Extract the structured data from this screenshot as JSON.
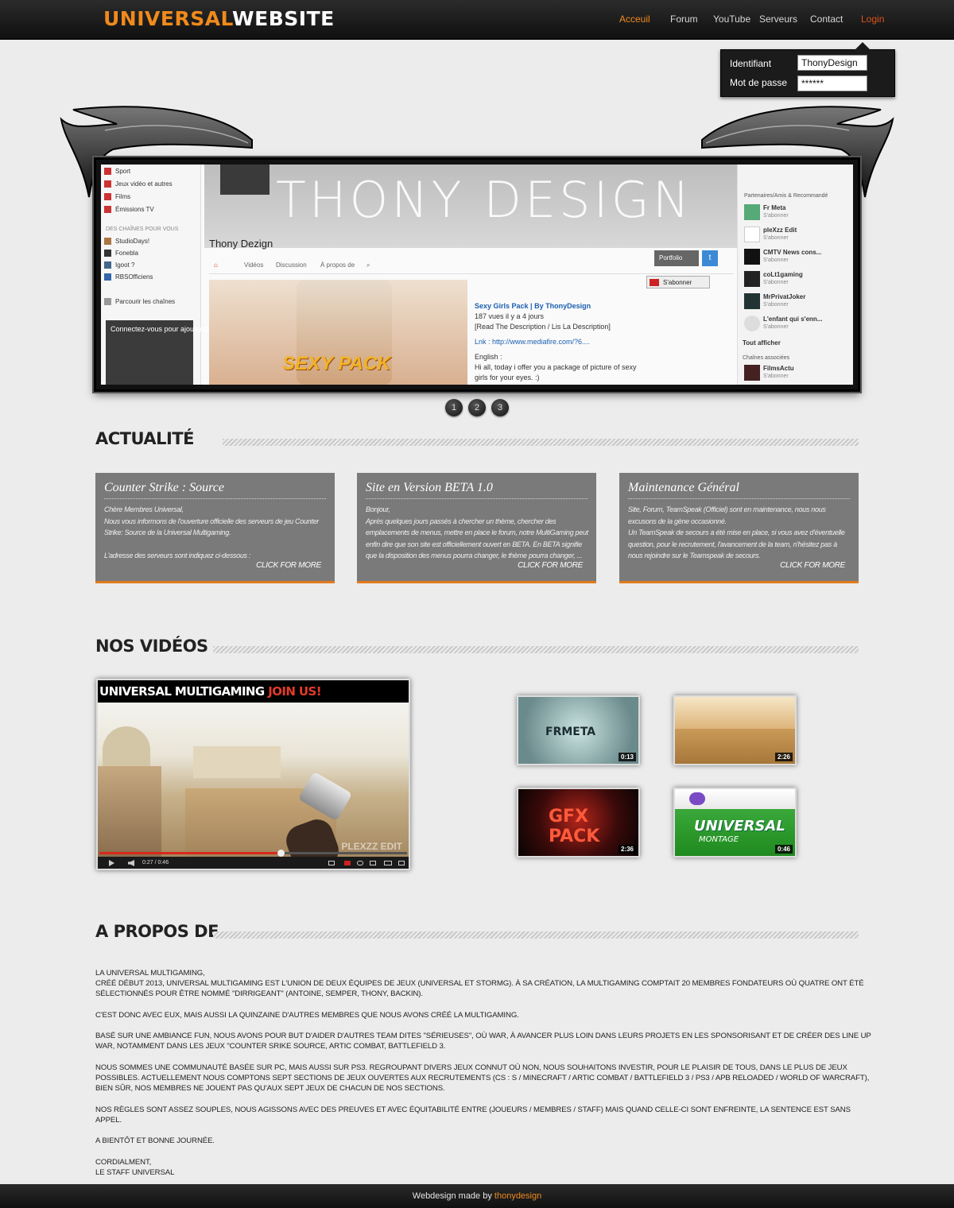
{
  "header": {
    "logo_part1": "UNIVERSAL",
    "logo_part2": "WEBSITE",
    "nav": [
      "Acceuil",
      "Forum",
      "YouTube",
      "Serveurs",
      "Contact",
      "Login"
    ]
  },
  "login": {
    "id_label": "Identifiant",
    "id_value": "ThonyDesign",
    "pw_label": "Mot de passe",
    "pw_value": "******"
  },
  "slider": {
    "sidebar": [
      "Sport",
      "Jeux vidéo et autres",
      "Films",
      "Émissions TV",
      "DES CHAÎNES POUR VOUS",
      "StudioDays!",
      "Fonebla",
      "Igoot ?",
      "RBSOfficiens",
      "Parcourir les chaînes"
    ],
    "promo": "Connectez-vous pour ajouter des chaînes à votre guide et bénéficier d'excellentes recommandations !",
    "banner_text": "THONY DESIGN",
    "channel_name": "Thony Dezign",
    "tabs": [
      "Vidéos",
      "Discussion",
      "À propos de"
    ],
    "portfolio": "Portfolio",
    "subscribe": "S'abonner",
    "video_overlay": "SEXY PACK",
    "desc_title": "Sexy Girls Pack | By ThonyDesign",
    "desc_meta": "187 vues  il y a 4 jours",
    "desc_line1": "[Read The Description / Lis La Description]",
    "desc_line2": "Lnk : http://www.mediafire.com/?6....",
    "desc_line3": "English :",
    "desc_line4": "Hi all, today i offer you a package of picture of sexy girls for your eyes. :)",
    "right_title": "Partenaires/Amis & Recommandé",
    "right_items": [
      "Fr Meta",
      "pleXzz Edit",
      "CMTV News cons...",
      "coLt1gaming",
      "MrPrivatJoker",
      "L'enfant qui s'enn..."
    ],
    "right_sub": "S'abonner",
    "right_more": "Tout afficher",
    "right_assoc": "Chaînes associées",
    "right_last": "FilmsActu",
    "dots": [
      "1",
      "2",
      "3"
    ]
  },
  "actualite": {
    "title": "ACTUALITÉ",
    "more_label": "CLICK FOR MORE",
    "cards": [
      {
        "title": "Counter Strike : Source",
        "body": "Chère Membres Universal,\nNous vous informons de l'ouverture officielle des serveurs de jeu Counter Strike: Source de la Universal Multigaming.\n\nL'adresse des serveurs sont indiquez ci-dessous :"
      },
      {
        "title": "Site en Version BETA 1.0",
        "body": "Bonjour,\nAprès quelques jours passés à chercher un thème, chercher des emplacements de menus, mettre en place le forum, notre MultiGaming peut enfin dire que son site est officiellement ouvert en BETA. En BETA signifie que la disposition des menus pourra changer, le thème pourra changer, ..."
      },
      {
        "title": "Maintenance Général",
        "body": "Site, Forum, TeamSpeak (Officiel) sont en maintenance, nous nous excusons de la gène occasionné.\nUn TeamSpeak de secours a été mise en place, si vous avez d'éventuelle question, pour le recrutement, l'avancement de la team, n'hésitez pas à nous rejoindre sur le Teamspeak de secours."
      }
    ]
  },
  "videos": {
    "title": "NOS VIDÉOS",
    "main_title": "UNIVERSAL MULTIGAMING",
    "main_join": "JOIN US!",
    "main_time": "0:27 / 0:46",
    "main_watermark": "PLEXZZ EDIT",
    "main_progress": 0.59,
    "thumbs": [
      {
        "label": "FRMETA",
        "duration": "0:13"
      },
      {
        "label": "",
        "duration": "2:26"
      },
      {
        "label": "GFX PACK",
        "duration": "2:36"
      },
      {
        "label": "UNIVERSAL",
        "sub": "MONTAGE",
        "duration": "0:46"
      }
    ]
  },
  "about": {
    "title": "A PROPOS DE",
    "paragraphs": [
      "La Universal MultiGaming,\nCréé début 2013, Universal MultiGaming est l'union de deux équipes de jeux (Universal et StormG). À sa création, la MultiGaming comptait 20 membres fondateurs où quatre ont été sélectionnés pour être nommé \"dirrigeant\" (Antoine, Semper, Thony, Backin).",
      "C'est donc avec eux, mais aussi la quinzaine d'autres membres que nous avons créé la MultiGaming.",
      "Basé sur une ambiance fun, nous avons pour but d'aider d'autres team dites \"sérieuses\", où war, à avancer plus loin dans leurs projets en les sponsorisant et de créer des line up war, notamment dans les jeux \"Counter Srike Source, Artic Combat, Battlefield 3.",
      "Nous sommes une communauté basée sur PC, mais aussi sur PS3. Regroupant divers jeux connut où non, nous souhaitons investir, pour le plaisir de tous, dans le plus de jeux possibles. Actuellement nous comptons sept sections de jeux ouvertes aux recrutements (CS : S / Minecraft / Artic Combat / Battlefield 3 / PS3 / APB Reloaded / World of Warcraft), bien sûr, nos membres ne jouent pas qu'aux sept jeux de chacun de nos sections.",
      "Nos règles sont assez souples, nous agissons avec des preuves et avec équitabilité entre (joueurs / membres / staff) mais quand celle-ci sont enfreinte, la sentence est sans appel.",
      "A bientôt et bonne journée.",
      "Cordialment,\nLe Staff Universal"
    ]
  },
  "footer": {
    "prefix": "Webdesign made  by ",
    "author": "thonydesign"
  },
  "colors": {
    "accent": "#f08a1c",
    "login": "#e0521c",
    "card_bg": "#7a7a7a"
  }
}
